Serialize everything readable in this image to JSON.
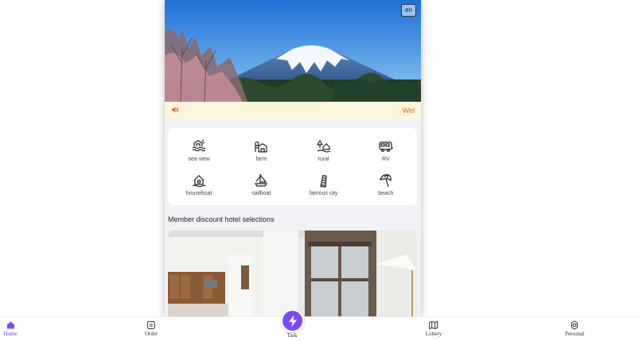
{
  "header": {
    "language_button": "en"
  },
  "notice": {
    "text": "Wel"
  },
  "categories": [
    {
      "label": "sea view",
      "icon": "sea-view-icon"
    },
    {
      "label": "farm",
      "icon": "farm-icon"
    },
    {
      "label": "rural",
      "icon": "rural-icon"
    },
    {
      "label": "RV",
      "icon": "rv-icon"
    },
    {
      "label": "houseboat",
      "icon": "houseboat-icon"
    },
    {
      "label": "sailboat",
      "icon": "sailboat-icon"
    },
    {
      "label": "famous city",
      "icon": "famous-city-icon"
    },
    {
      "label": "beach",
      "icon": "beach-icon"
    }
  ],
  "section": {
    "title": "Member discount hotel selections"
  },
  "tabbar": {
    "home": "Home",
    "order": "Order",
    "task": "Task",
    "lottery": "Lottery",
    "personal": "Personal"
  },
  "colors": {
    "accent": "#6a3df0",
    "notice_text": "#e26a2c",
    "notice_bg": "#fdf6dc"
  }
}
